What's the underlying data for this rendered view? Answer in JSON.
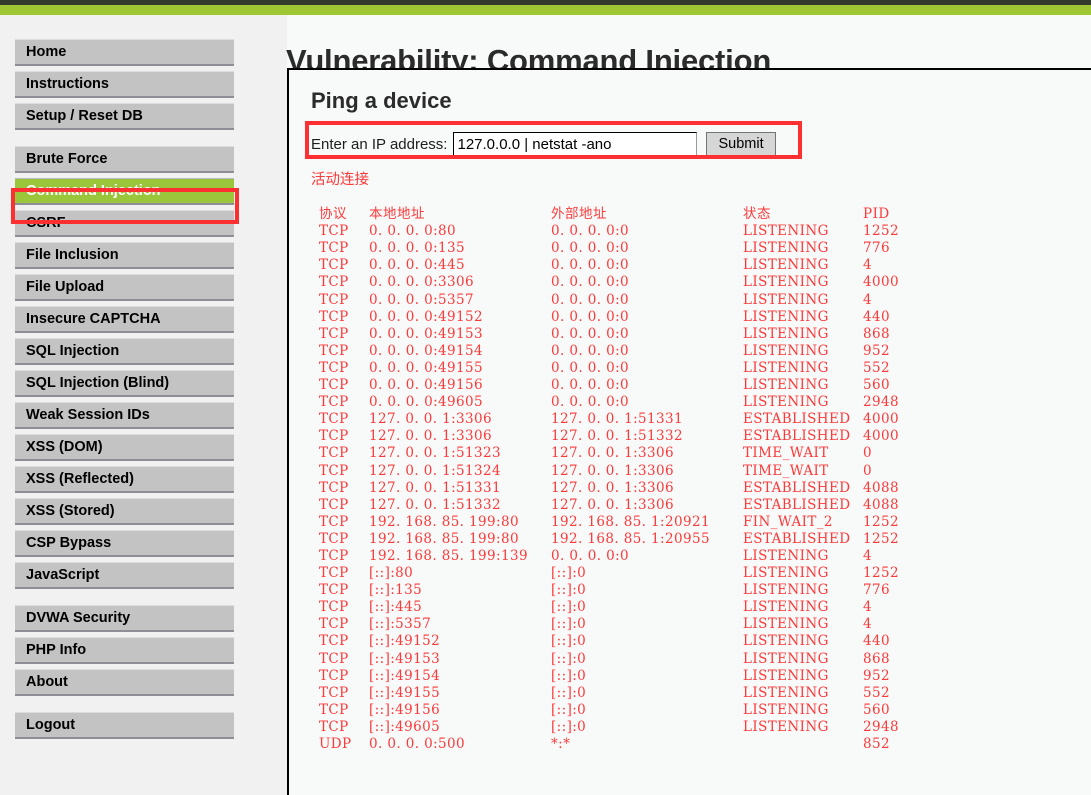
{
  "page": {
    "title": "Vulnerability: Command Injection",
    "panel_title": "Ping a device"
  },
  "colors": {
    "accent_green": "#9fc633",
    "nav_active_green": "#9ac63b",
    "annotation_red": "#fc3030",
    "output_red": "#fd3a3a",
    "nav_grey": "#c3c3c3",
    "topbar_dark": "#333c2c"
  },
  "sidebar": {
    "groups": [
      {
        "items": [
          {
            "label": "Home",
            "active": false
          },
          {
            "label": "Instructions",
            "active": false
          },
          {
            "label": "Setup / Reset DB",
            "active": false
          }
        ]
      },
      {
        "items": [
          {
            "label": "Brute Force",
            "active": false
          },
          {
            "label": "Command Injection",
            "active": true
          },
          {
            "label": "CSRF",
            "active": false
          },
          {
            "label": "File Inclusion",
            "active": false
          },
          {
            "label": "File Upload",
            "active": false
          },
          {
            "label": "Insecure CAPTCHA",
            "active": false
          },
          {
            "label": "SQL Injection",
            "active": false
          },
          {
            "label": "SQL Injection (Blind)",
            "active": false
          },
          {
            "label": "Weak Session IDs",
            "active": false
          },
          {
            "label": "XSS (DOM)",
            "active": false
          },
          {
            "label": "XSS (Reflected)",
            "active": false
          },
          {
            "label": "XSS (Stored)",
            "active": false
          },
          {
            "label": "CSP Bypass",
            "active": false
          },
          {
            "label": "JavaScript",
            "active": false
          }
        ]
      },
      {
        "items": [
          {
            "label": "DVWA Security",
            "active": false
          },
          {
            "label": "PHP Info",
            "active": false
          },
          {
            "label": "About",
            "active": false
          }
        ]
      },
      {
        "items": [
          {
            "label": "Logout",
            "active": false
          }
        ]
      }
    ]
  },
  "form": {
    "label": "Enter an IP address:",
    "input_value": "127.0.0.0 | netstat -ano",
    "input_placeholder": "",
    "submit_label": "Submit"
  },
  "output": {
    "caption": "活动连接",
    "headers": [
      "协议",
      "本地地址",
      "外部地址",
      "状态",
      "PID"
    ],
    "rows": [
      [
        "TCP",
        "0. 0. 0. 0:80",
        "0. 0. 0. 0:0",
        "LISTENING",
        "1252"
      ],
      [
        "TCP",
        "0. 0. 0. 0:135",
        "0. 0. 0. 0:0",
        "LISTENING",
        "776"
      ],
      [
        "TCP",
        "0. 0. 0. 0:445",
        "0. 0. 0. 0:0",
        "LISTENING",
        "4"
      ],
      [
        "TCP",
        "0. 0. 0. 0:3306",
        "0. 0. 0. 0:0",
        "LISTENING",
        "4000"
      ],
      [
        "TCP",
        "0. 0. 0. 0:5357",
        "0. 0. 0. 0:0",
        "LISTENING",
        "4"
      ],
      [
        "TCP",
        "0. 0. 0. 0:49152",
        "0. 0. 0. 0:0",
        "LISTENING",
        "440"
      ],
      [
        "TCP",
        "0. 0. 0. 0:49153",
        "0. 0. 0. 0:0",
        "LISTENING",
        "868"
      ],
      [
        "TCP",
        "0. 0. 0. 0:49154",
        "0. 0. 0. 0:0",
        "LISTENING",
        "952"
      ],
      [
        "TCP",
        "0. 0. 0. 0:49155",
        "0. 0. 0. 0:0",
        "LISTENING",
        "552"
      ],
      [
        "TCP",
        "0. 0. 0. 0:49156",
        "0. 0. 0. 0:0",
        "LISTENING",
        "560"
      ],
      [
        "TCP",
        "0. 0. 0. 0:49605",
        "0. 0. 0. 0:0",
        "LISTENING",
        "2948"
      ],
      [
        "TCP",
        "127. 0. 0. 1:3306",
        "127. 0. 0. 1:51331",
        "ESTABLISHED",
        "4000"
      ],
      [
        "TCP",
        "127. 0. 0. 1:3306",
        "127. 0. 0. 1:51332",
        "ESTABLISHED",
        "4000"
      ],
      [
        "TCP",
        "127. 0. 0. 1:51323",
        "127. 0. 0. 1:3306",
        "TIME_WAIT",
        "0"
      ],
      [
        "TCP",
        "127. 0. 0. 1:51324",
        "127. 0. 0. 1:3306",
        "TIME_WAIT",
        "0"
      ],
      [
        "TCP",
        "127. 0. 0. 1:51331",
        "127. 0. 0. 1:3306",
        "ESTABLISHED",
        "4088"
      ],
      [
        "TCP",
        "127. 0. 0. 1:51332",
        "127. 0. 0. 1:3306",
        "ESTABLISHED",
        "4088"
      ],
      [
        "TCP",
        "192. 168. 85. 199:80",
        "192. 168. 85. 1:20921",
        "FIN_WAIT_2",
        "1252"
      ],
      [
        "TCP",
        "192. 168. 85. 199:80",
        "192. 168. 85. 1:20955",
        "ESTABLISHED",
        "1252"
      ],
      [
        "TCP",
        "192. 168. 85. 199:139",
        "0. 0. 0. 0:0",
        "LISTENING",
        "4"
      ],
      [
        "TCP",
        "[::]:80",
        "[::]:0",
        "LISTENING",
        "1252"
      ],
      [
        "TCP",
        "[::]:135",
        "[::]:0",
        "LISTENING",
        "776"
      ],
      [
        "TCP",
        "[::]:445",
        "[::]:0",
        "LISTENING",
        "4"
      ],
      [
        "TCP",
        "[::]:5357",
        "[::]:0",
        "LISTENING",
        "4"
      ],
      [
        "TCP",
        "[::]:49152",
        "[::]:0",
        "LISTENING",
        "440"
      ],
      [
        "TCP",
        "[::]:49153",
        "[::]:0",
        "LISTENING",
        "868"
      ],
      [
        "TCP",
        "[::]:49154",
        "[::]:0",
        "LISTENING",
        "952"
      ],
      [
        "TCP",
        "[::]:49155",
        "[::]:0",
        "LISTENING",
        "552"
      ],
      [
        "TCP",
        "[::]:49156",
        "[::]:0",
        "LISTENING",
        "560"
      ],
      [
        "TCP",
        "[::]:49605",
        "[::]:0",
        "LISTENING",
        "2948"
      ],
      [
        "UDP",
        "0. 0. 0. 0:500",
        "*:*",
        "",
        "852"
      ]
    ]
  }
}
